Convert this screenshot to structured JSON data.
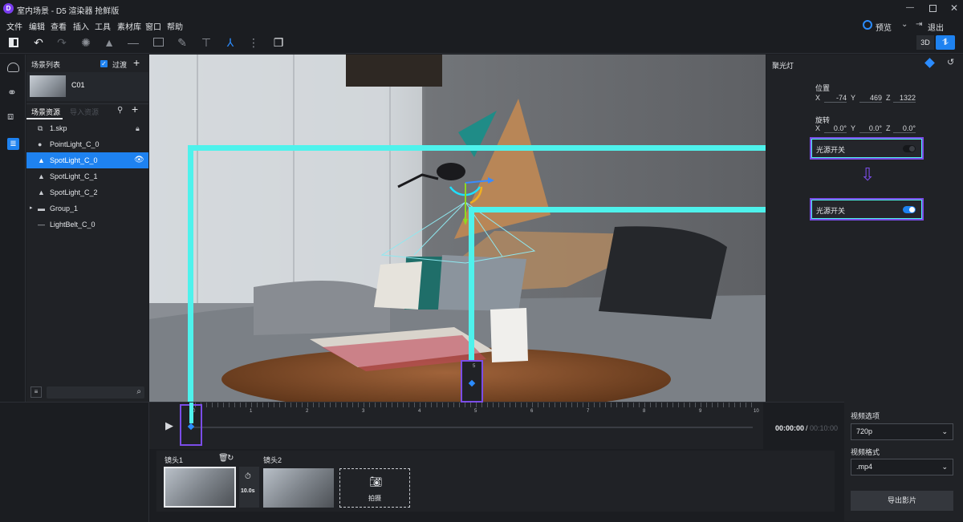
{
  "window": {
    "title": "室内场景 - D5 渲染器 抢鲜版"
  },
  "menu": [
    "文件",
    "编辑",
    "查看",
    "插入",
    "工具",
    "素材库",
    "窗口",
    "帮助"
  ],
  "top_right": {
    "preview_label": "预览",
    "exit_label": "退出"
  },
  "view_mode": {
    "label_3d": "3D"
  },
  "scene_list": {
    "title": "场景列表",
    "filter_label": "过渡",
    "scene_name": "C01"
  },
  "resources": {
    "tabs": [
      "场景资源",
      "导入资源"
    ],
    "items": [
      {
        "label": "1.skp",
        "icon": "file-icon"
      },
      {
        "label": "PointLight_C_0",
        "icon": "point-light-icon"
      },
      {
        "label": "SpotLight_C_0",
        "icon": "spot-light-icon"
      },
      {
        "label": "SpotLight_C_1",
        "icon": "spot-light-icon"
      },
      {
        "label": "SpotLight_C_2",
        "icon": "spot-light-icon"
      },
      {
        "label": "Group_1",
        "icon": "group-icon"
      },
      {
        "label": "LightBelt_C_0",
        "icon": "light-belt-icon"
      }
    ],
    "selected_index": 2
  },
  "properties": {
    "title": "聚光灯",
    "position_label": "位置",
    "position": {
      "x": "-74",
      "y": "469",
      "z": "1322"
    },
    "rotation_label": "旋转",
    "rotation": {
      "x": "0.0°",
      "y": "0.0°",
      "z": "0.0°"
    },
    "switch_off": {
      "label": "光源开关",
      "state": "off"
    },
    "switch_on": {
      "label": "光源开关",
      "state": "on"
    }
  },
  "timeline": {
    "ticks": [
      "0",
      "1",
      "2",
      "3",
      "4",
      "5",
      "6",
      "7",
      "8",
      "9",
      "10"
    ],
    "marker_label": "5",
    "current_time": "00:00:00",
    "separator": "/",
    "total_time": "00:10:00"
  },
  "shots": {
    "shot1_label": "镜头1",
    "shot2_label": "镜头2",
    "duration": "10.0s",
    "capture_label": "拍摄"
  },
  "video": {
    "options_label": "视频选项",
    "resolution": "720p",
    "format_label": "视频格式",
    "format": ".mp4",
    "export_label": "导出影片"
  },
  "colors": {
    "accent": "#1e82f0",
    "annotation_cyan": "#4ef2ec",
    "annotation_purple": "#7b4de8"
  }
}
